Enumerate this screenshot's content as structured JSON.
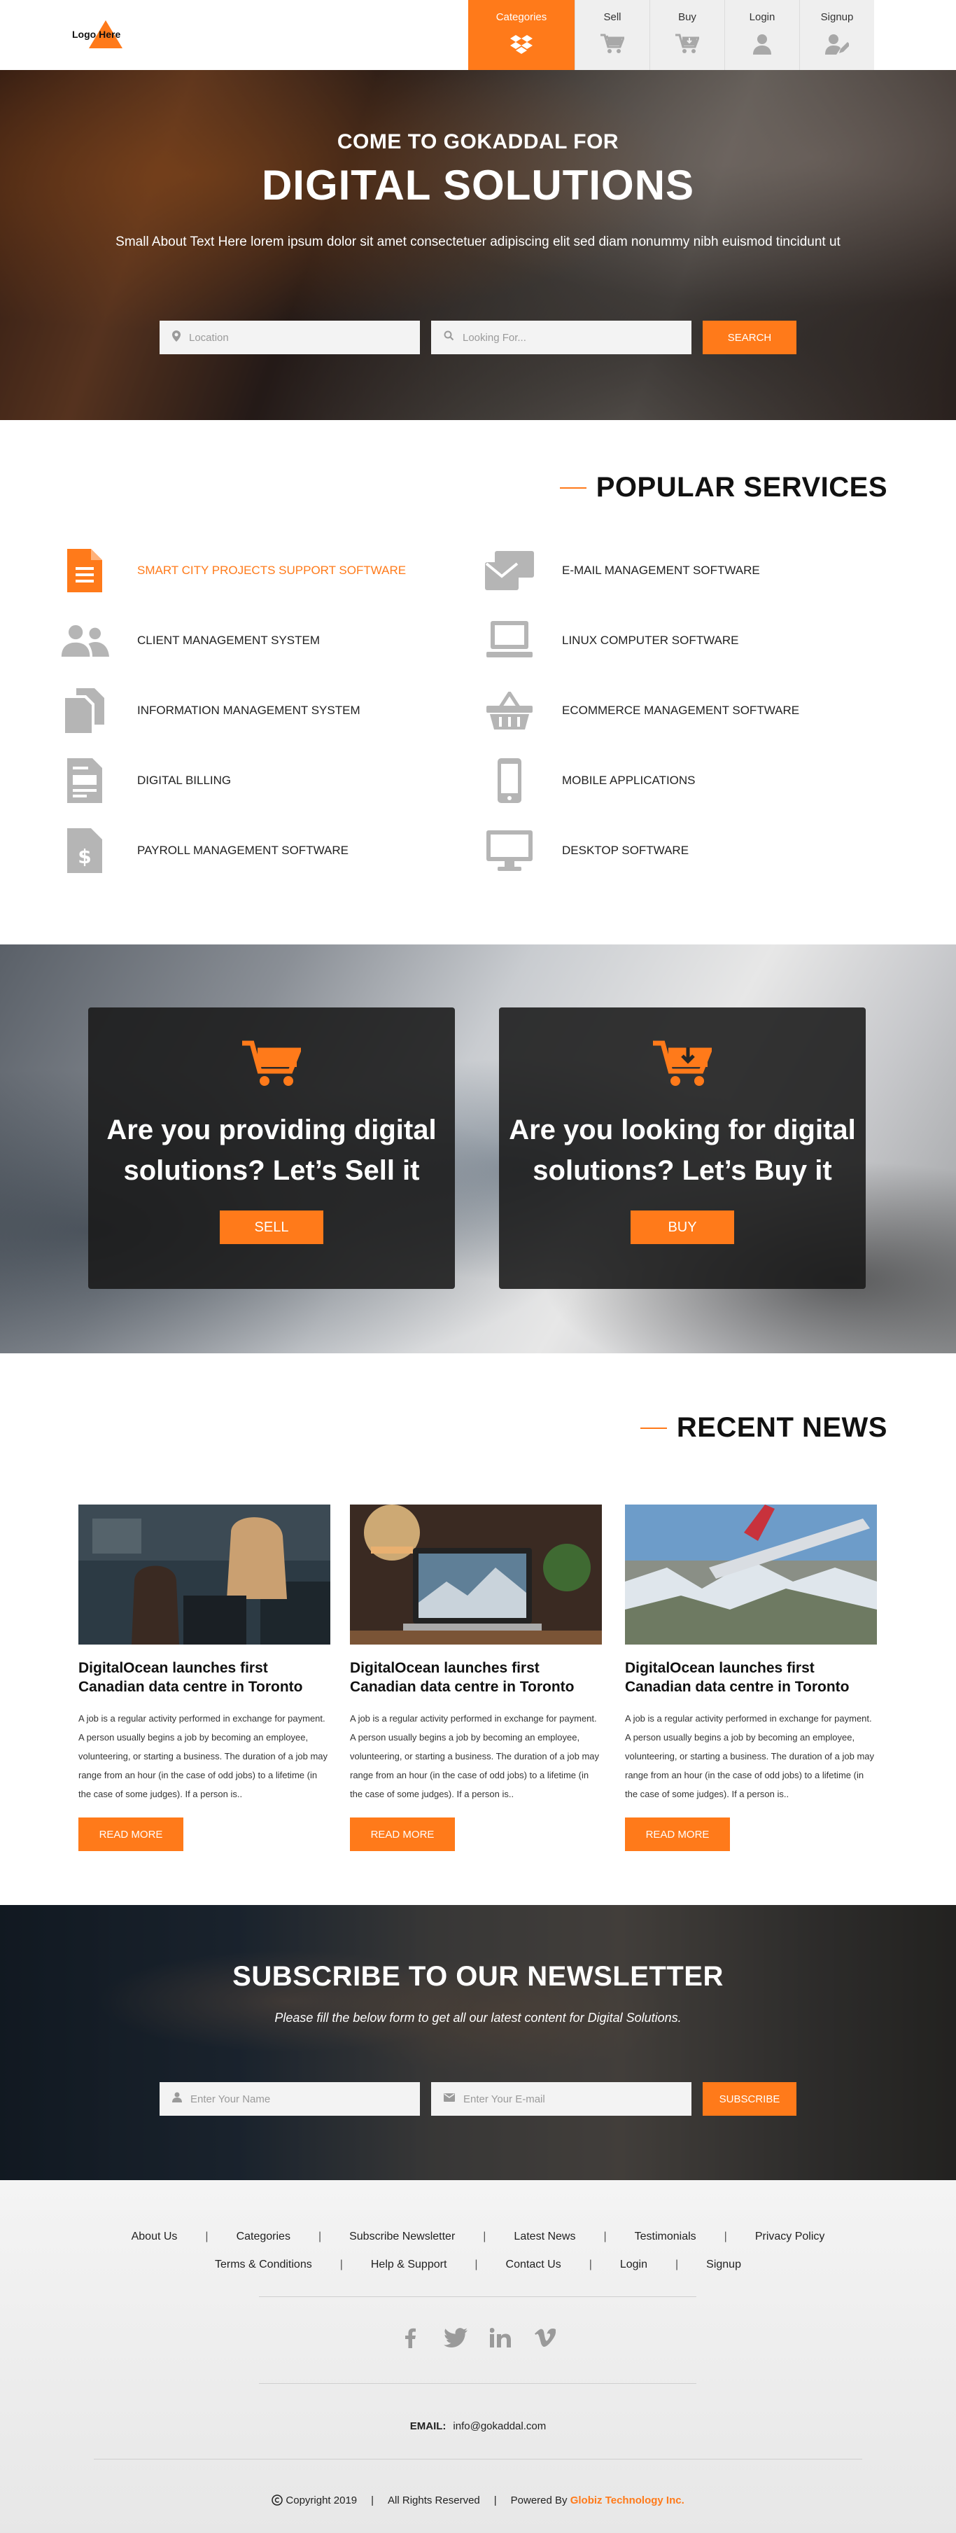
{
  "header": {
    "logo_text": "Logo Here",
    "nav": [
      {
        "label": "Categories",
        "icon": "dropbox-icon",
        "active": true
      },
      {
        "label": "Sell",
        "icon": "cart-icon"
      },
      {
        "label": "Buy",
        "icon": "cart-download-icon"
      },
      {
        "label": "Login",
        "icon": "user-icon"
      },
      {
        "label": "Signup",
        "icon": "user-edit-icon"
      }
    ]
  },
  "hero": {
    "pretitle": "COME TO GOKADDAL FOR",
    "title": "DIGITAL SOLUTIONS",
    "text": "Small About Text Here lorem ipsum dolor sit amet consectetuer adipiscing elit sed diam nonummy nibh euismod tincidunt ut",
    "location_placeholder": "Location",
    "looking_placeholder": "Looking For...",
    "search_label": "SEARCH"
  },
  "services": {
    "title": "POPULAR SERVICES",
    "items": [
      {
        "label": "SMART CITY PROJECTS SUPPORT SOFTWARE",
        "icon": "document-icon",
        "active": true
      },
      {
        "label": "E-MAIL MANAGEMENT SOFTWARE",
        "icon": "email-icon"
      },
      {
        "label": "CLIENT MANAGEMENT SYSTEM",
        "icon": "users-icon"
      },
      {
        "label": "LINUX COMPUTER SOFTWARE",
        "icon": "laptop-icon"
      },
      {
        "label": "INFORMATION MANAGEMENT SYSTEM",
        "icon": "files-icon"
      },
      {
        "label": "ECOMMERCE MANAGEMENT SOFTWARE",
        "icon": "basket-icon"
      },
      {
        "label": "DIGITAL BILLING",
        "icon": "billing-icon"
      },
      {
        "label": "MOBILE APPLICATIONS",
        "icon": "mobile-icon"
      },
      {
        "label": "PAYROLL MANAGEMENT SOFTWARE",
        "icon": "dollar-file-icon"
      },
      {
        "label": "DESKTOP SOFTWARE",
        "icon": "desktop-icon"
      }
    ]
  },
  "cta": {
    "sell": {
      "line1": "Are you providing digital",
      "line2": "solutions?  Let’s Sell it",
      "button": "SELL"
    },
    "buy": {
      "line1": "Are you looking for digital",
      "line2": "solutions?  Let’s Buy it",
      "button": "BUY"
    }
  },
  "news": {
    "title": "RECENT NEWS",
    "items": [
      {
        "title": "DigitalOcean launches first Canadian data centre in Toronto",
        "body": "A job is a regular activity performed in exchange for payment. A person usually begins a job by becoming an employee, volunteering, or starting a business. The duration of a job may range from an hour (in the case of odd jobs) to a lifetime (in the case of some judges). If a person is..",
        "button": "READ MORE"
      },
      {
        "title": "DigitalOcean launches first Canadian data centre in Toronto",
        "body": "A job is a regular activity performed in exchange for payment. A person usually begins a job by becoming an employee, volunteering, or starting a business. The duration of a job may range from an hour (in the case of odd jobs) to a lifetime (in the case of some judges). If a person is..",
        "button": "READ MORE"
      },
      {
        "title": "DigitalOcean launches first Canadian data centre in Toronto",
        "body": "A job is a regular activity performed in exchange for payment. A person usually begins a job by becoming an employee, volunteering, or starting a business. The duration of a job may range from an hour (in the case of odd jobs) to a lifetime (in the case of some judges). If a person is..",
        "button": "READ MORE"
      }
    ]
  },
  "newsletter": {
    "title": "SUBSCRIBE TO OUR NEWSLETTER",
    "subtitle": "Please fill the below form to get all our latest content for Digital Solutions.",
    "name_placeholder": "Enter Your Name",
    "email_placeholder": "Enter Your E-mail",
    "button": "SUBSCRIBE"
  },
  "footer": {
    "links_row1": [
      "About Us",
      "Categories",
      "Subscribe Newsletter",
      "Latest News",
      "Testimonials",
      "Privacy Policy"
    ],
    "links_row2": [
      "Terms & Conditions",
      "Help & Support",
      "Contact Us",
      "Login",
      "Signup"
    ],
    "social": [
      "facebook-icon",
      "twitter-icon",
      "linkedin-icon",
      "vimeo-icon"
    ],
    "email_label": "EMAIL:",
    "email": "info@gokaddal.com",
    "copyright": "Copyright 2019",
    "rights": "All Rights Reserved",
    "powered_by": "Powered By",
    "company": "Globiz Technology Inc."
  },
  "colors": {
    "accent": "#ff7a1a",
    "icon_grey": "#b5b5b5"
  }
}
